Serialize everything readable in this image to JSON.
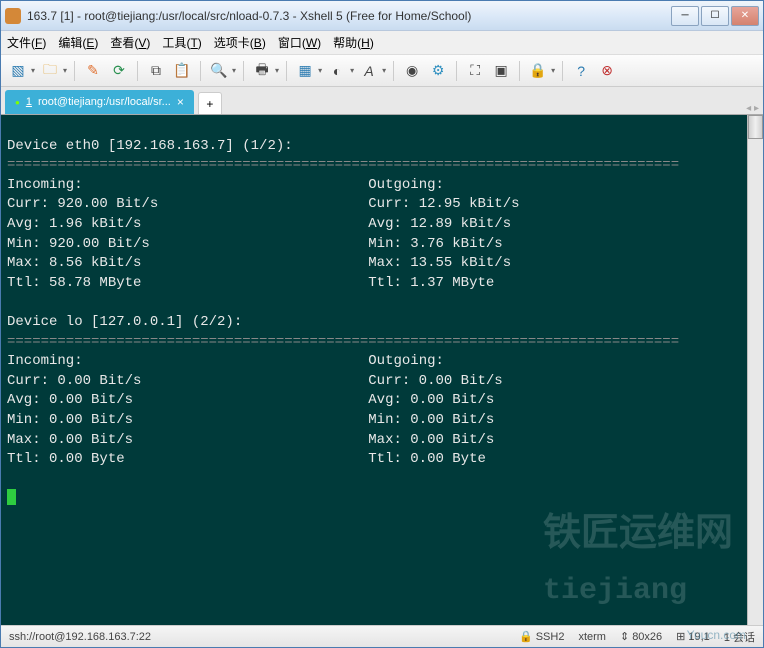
{
  "titlebar": {
    "title": "163.7 [1]  - root@tiejiang:/usr/local/src/nload-0.7.3 - Xshell 5 (Free for Home/School)"
  },
  "menubar": {
    "items": [
      {
        "label": "文件",
        "key": "F"
      },
      {
        "label": "编辑",
        "key": "E"
      },
      {
        "label": "查看",
        "key": "V"
      },
      {
        "label": "工具",
        "key": "T"
      },
      {
        "label": "选项卡",
        "key": "B"
      },
      {
        "label": "窗口",
        "key": "W"
      },
      {
        "label": "帮助",
        "key": "H"
      }
    ]
  },
  "tab": {
    "indicator": "●",
    "number": "1",
    "label": "root@tiejiang:/usr/local/sr..."
  },
  "terminal": {
    "dev0": {
      "header": "Device eth0 [192.168.163.7] (1/2):",
      "incoming": {
        "title": "Incoming:",
        "curr": "Curr: 920.00 Bit/s",
        "avg": "Avg: 1.96 kBit/s",
        "min": "Min: 920.00 Bit/s",
        "max": "Max: 8.56 kBit/s",
        "ttl": "Ttl: 58.78 MByte"
      },
      "outgoing": {
        "title": "Outgoing:",
        "curr": "Curr: 12.95 kBit/s",
        "avg": "Avg: 12.89 kBit/s",
        "min": "Min: 3.76 kBit/s",
        "max": "Max: 13.55 kBit/s",
        "ttl": "Ttl: 1.37 MByte"
      }
    },
    "dev1": {
      "header": "Device lo [127.0.0.1] (2/2):",
      "incoming": {
        "title": "Incoming:",
        "curr": "Curr: 0.00 Bit/s",
        "avg": "Avg: 0.00 Bit/s",
        "min": "Min: 0.00 Bit/s",
        "max": "Max: 0.00 Bit/s",
        "ttl": "Ttl: 0.00 Byte"
      },
      "outgoing": {
        "title": "Outgoing:",
        "curr": "Curr: 0.00 Bit/s",
        "avg": "Avg: 0.00 Bit/s",
        "min": "Min: 0.00 Bit/s",
        "max": "Max: 0.00 Bit/s",
        "ttl": "Ttl: 0.00 Byte"
      }
    },
    "hr": "================================================================================"
  },
  "statusbar": {
    "conn": "ssh://root@192.168.163.7:22",
    "proto": "SSH2",
    "term": "xterm",
    "size": "80x26",
    "pos": "19,1",
    "sess": "1 会话",
    "brand": "Yuucn.com"
  },
  "watermark": {
    "big": "铁匠运维网",
    "url": "tiejiang"
  }
}
